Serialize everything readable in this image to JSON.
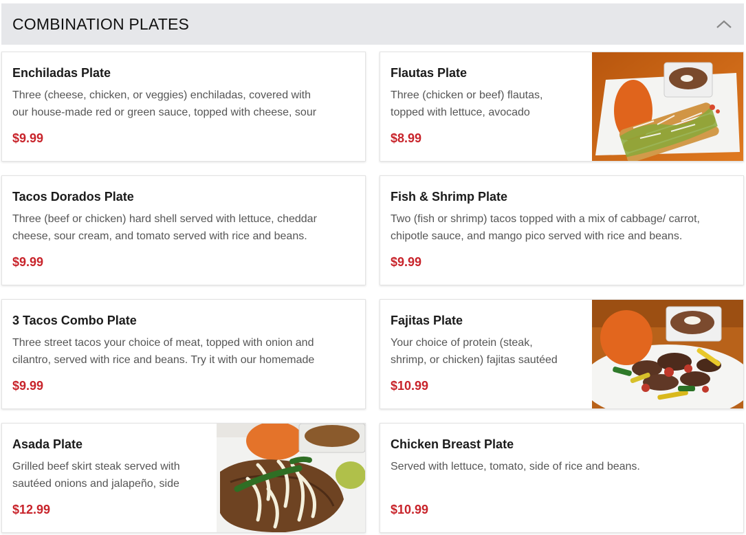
{
  "section": {
    "title": "COMBINATION PLATES",
    "toggle_icon": "chevron-up-icon"
  },
  "items": [
    {
      "name": "Enchiladas Plate",
      "desc_line1": "Three (cheese, chicken, or veggies) enchiladas, covered with",
      "desc_line2": "our house-made red or green sauce, topped with cheese, sour",
      "price": "$9.99"
    },
    {
      "name": "Flautas Plate",
      "desc_line1": "Three (chicken or beef) flautas,",
      "desc_line2": "topped with lettuce, avocado",
      "price": "$8.99",
      "photo": "flautas-photo"
    },
    {
      "name": "Tacos Dorados Plate",
      "desc_line1": "Three (beef or chicken) hard shell served with lettuce, cheddar",
      "desc_line2": "cheese, sour cream, and tomato served with rice and beans.",
      "price": "$9.99"
    },
    {
      "name": "Fish & Shrimp Plate",
      "desc_line1": "Two (fish or shrimp) tacos topped with a mix of cabbage/ carrot,",
      "desc_line2": "chipotle sauce, and mango pico served with rice and beans.",
      "price": "$9.99"
    },
    {
      "name": "3 Tacos Combo Plate",
      "desc_line1": "Three street tacos your choice of meat, topped with onion and",
      "desc_line2": "cilantro, served with rice and beans. Try it with our homemade",
      "price": "$9.99"
    },
    {
      "name": "Fajitas Plate",
      "desc_line1": "Your choice of protein (steak,",
      "desc_line2": "shrimp, or chicken) fajitas sautéed",
      "price": "$10.99",
      "photo": "fajitas-photo"
    },
    {
      "name": "Asada Plate",
      "desc_line1": "Grilled beef skirt steak served with",
      "desc_line2": "sautéed onions and jalapeño, side",
      "price": "$12.99",
      "photo": "asada-photo"
    },
    {
      "name": "Chicken Breast Plate",
      "desc_line1": "Served with lettuce, tomato, side of rice and beans.",
      "desc_line2": "",
      "price": "$10.99"
    }
  ],
  "colors": {
    "price": "#c8242b",
    "header_bg": "#e6e7ea"
  }
}
